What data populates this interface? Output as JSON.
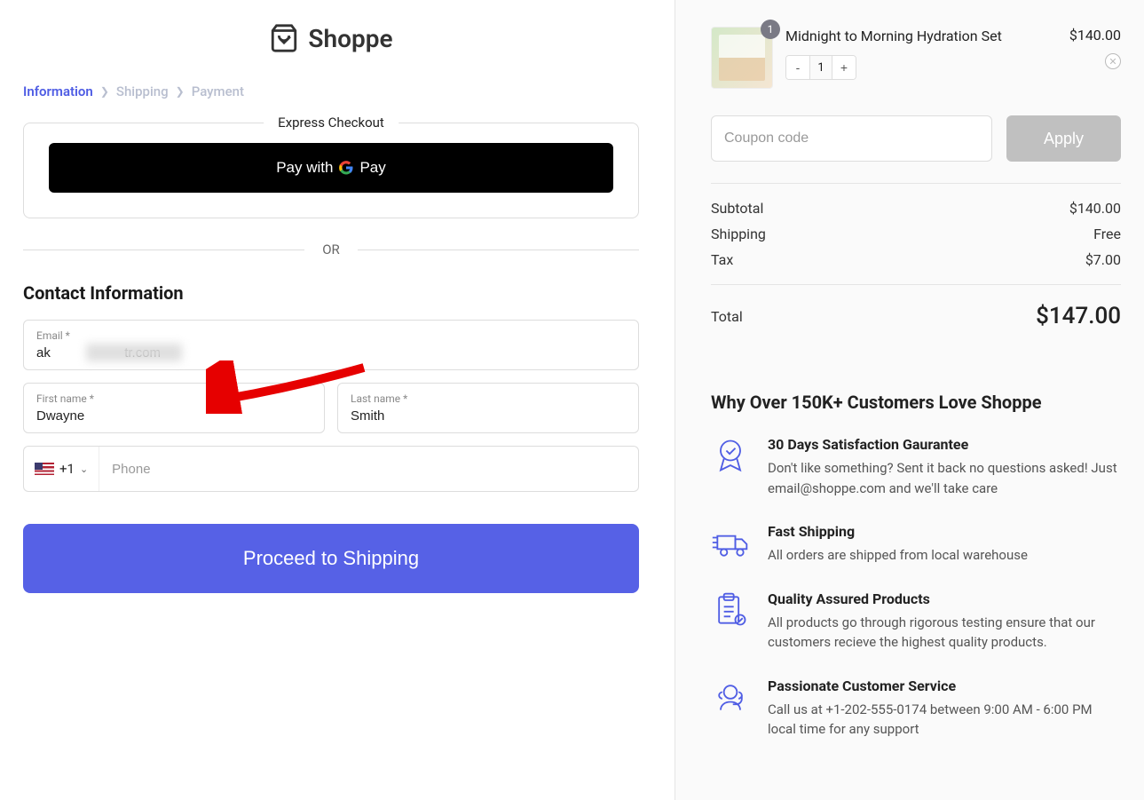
{
  "logo": {
    "text": "Shoppe"
  },
  "breadcrumb": {
    "information": "Information",
    "shipping": "Shipping",
    "payment": "Payment"
  },
  "express": {
    "label": "Express Checkout",
    "pay_with": "Pay with",
    "gpay": "Pay"
  },
  "divider": {
    "or": "OR"
  },
  "contact": {
    "title": "Contact Information",
    "email_label": "Email *",
    "email_value": "ak                    tr.com",
    "first_name_label": "First name *",
    "first_name_value": "Dwayne",
    "last_name_label": "Last name *",
    "last_name_value": "Smith",
    "phone_code": "+1",
    "phone_placeholder": "Phone"
  },
  "proceed": "Proceed to Shipping",
  "cart": {
    "item": {
      "name": "Midnight to Morning Hydration Set",
      "price": "$140.00",
      "qty": "1",
      "badge": "1"
    },
    "coupon_placeholder": "Coupon code",
    "apply": "Apply",
    "subtotal_label": "Subtotal",
    "subtotal_value": "$140.00",
    "shipping_label": "Shipping",
    "shipping_value": "Free",
    "tax_label": "Tax",
    "tax_value": "$7.00",
    "total_label": "Total",
    "total_value": "$147.00"
  },
  "why": {
    "title": "Why Over 150K+ Customers Love Shoppe",
    "benefits": [
      {
        "title": "30 Days Satisfaction Gaurantee",
        "desc": "Don't like something? Sent it back no questions asked! Just email@shoppe.com and we'll take care"
      },
      {
        "title": "Fast Shipping",
        "desc": "All orders are shipped from local warehouse"
      },
      {
        "title": "Quality Assured Products",
        "desc": "All products go through rigorous testing ensure that our customers recieve the highest quality products."
      },
      {
        "title": "Passionate Customer Service",
        "desc": "Call us at +1-202-555-0174 between 9:00 AM - 6:00 PM local time for any support"
      }
    ]
  }
}
